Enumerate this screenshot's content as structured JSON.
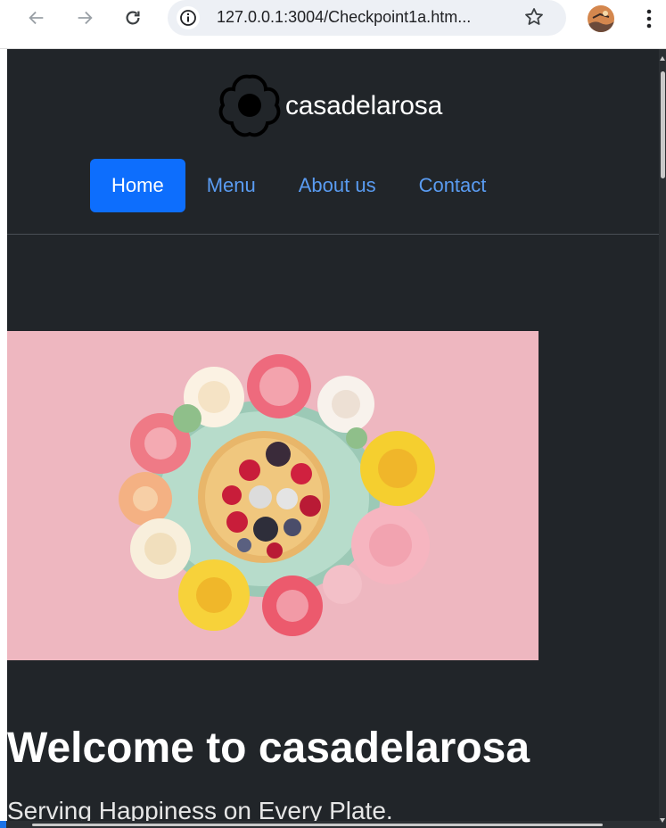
{
  "browser": {
    "url": "127.0.0.1:3004/Checkpoint1a.htm...",
    "back_icon": "arrow-left-icon",
    "forward_icon": "arrow-right-icon",
    "reload_icon": "reload-icon",
    "info_icon": "info-icon",
    "bookmark_icon": "star-icon",
    "menu_icon": "kebab-menu-icon"
  },
  "site": {
    "brand": "casadelarosa",
    "logo_icon": "flower-logo-icon",
    "nav": [
      {
        "label": "Home",
        "active": true
      },
      {
        "label": "Menu",
        "active": false
      },
      {
        "label": "About us",
        "active": false
      },
      {
        "label": "Contact",
        "active": false
      }
    ],
    "hero": {
      "title": "Welcome to casadelarosa",
      "subtitle": "Serving Happiness on Every Plate."
    }
  },
  "colors": {
    "page_bg": "#212529",
    "active_nav_bg": "#0d6efd",
    "nav_link": "#5a9cf2",
    "image_bg": "#f0bcc4"
  }
}
